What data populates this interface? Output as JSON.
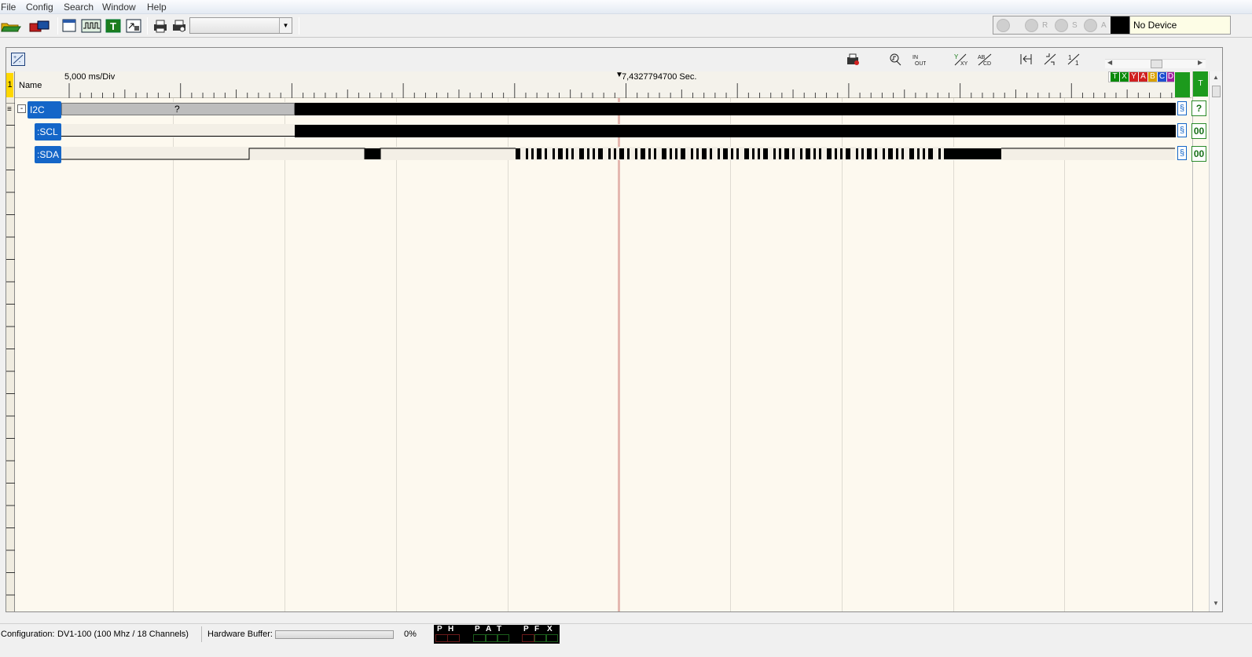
{
  "menu": [
    "File",
    "Config",
    "Search",
    "Window",
    "Help"
  ],
  "device": {
    "run_labels": [
      "R",
      "S",
      "A"
    ],
    "name": "No Device"
  },
  "timeline": {
    "scale": "5,000 ms/Div",
    "cursor_time": "7,4327794700 Sec.",
    "name_header": "Name",
    "group_index": "1"
  },
  "channel_letters": [
    {
      "text": "T",
      "color": "#0a8a0a"
    },
    {
      "text": "X",
      "color": "#0a8a0a"
    },
    {
      "text": "Y",
      "color": "#d02020"
    },
    {
      "text": "A",
      "color": "#d02020"
    },
    {
      "text": "B",
      "color": "#d8a000"
    },
    {
      "text": "C",
      "color": "#2050d0"
    },
    {
      "text": "D",
      "color": "#a020a0"
    }
  ],
  "trigger_label": "T",
  "signals": [
    {
      "name": "I2C",
      "collapse": "-",
      "decode_text": "?",
      "value": "?"
    },
    {
      "name": ":SCL",
      "value": "00"
    },
    {
      "name": ":SDA",
      "value": "00"
    }
  ],
  "status": {
    "config_label": "Configuration:",
    "config_value": "DV1-100 (100 Mhz / 18 Channels)",
    "buffer_label": "Hardware Buffer:",
    "buffer_fraction": 0,
    "buffer_percent": "0%",
    "led_letters": [
      "P",
      "H",
      "P",
      "A",
      "T",
      "P",
      "F",
      "X"
    ]
  },
  "colors": {
    "signal_tag": "#1466c8",
    "value_green": "#167016",
    "cursor": "#e4b8b0",
    "panel_bg": "#fdf9ef"
  },
  "icons": [
    "open-folder-icon",
    "device-icon",
    "window-icon",
    "waveform-icon",
    "text-icon",
    "export-icon",
    "print-icon",
    "print-setup-icon",
    "capture-icon",
    "zoom-edge-icon",
    "in-out-icon",
    "xy-icon",
    "abcd-icon",
    "jump-icon",
    "zoom-fit-icon",
    "zoom-ratio-icon",
    "scroll-left-icon",
    "scroll-right-icon",
    "scroll-up-icon",
    "scroll-down-icon"
  ]
}
